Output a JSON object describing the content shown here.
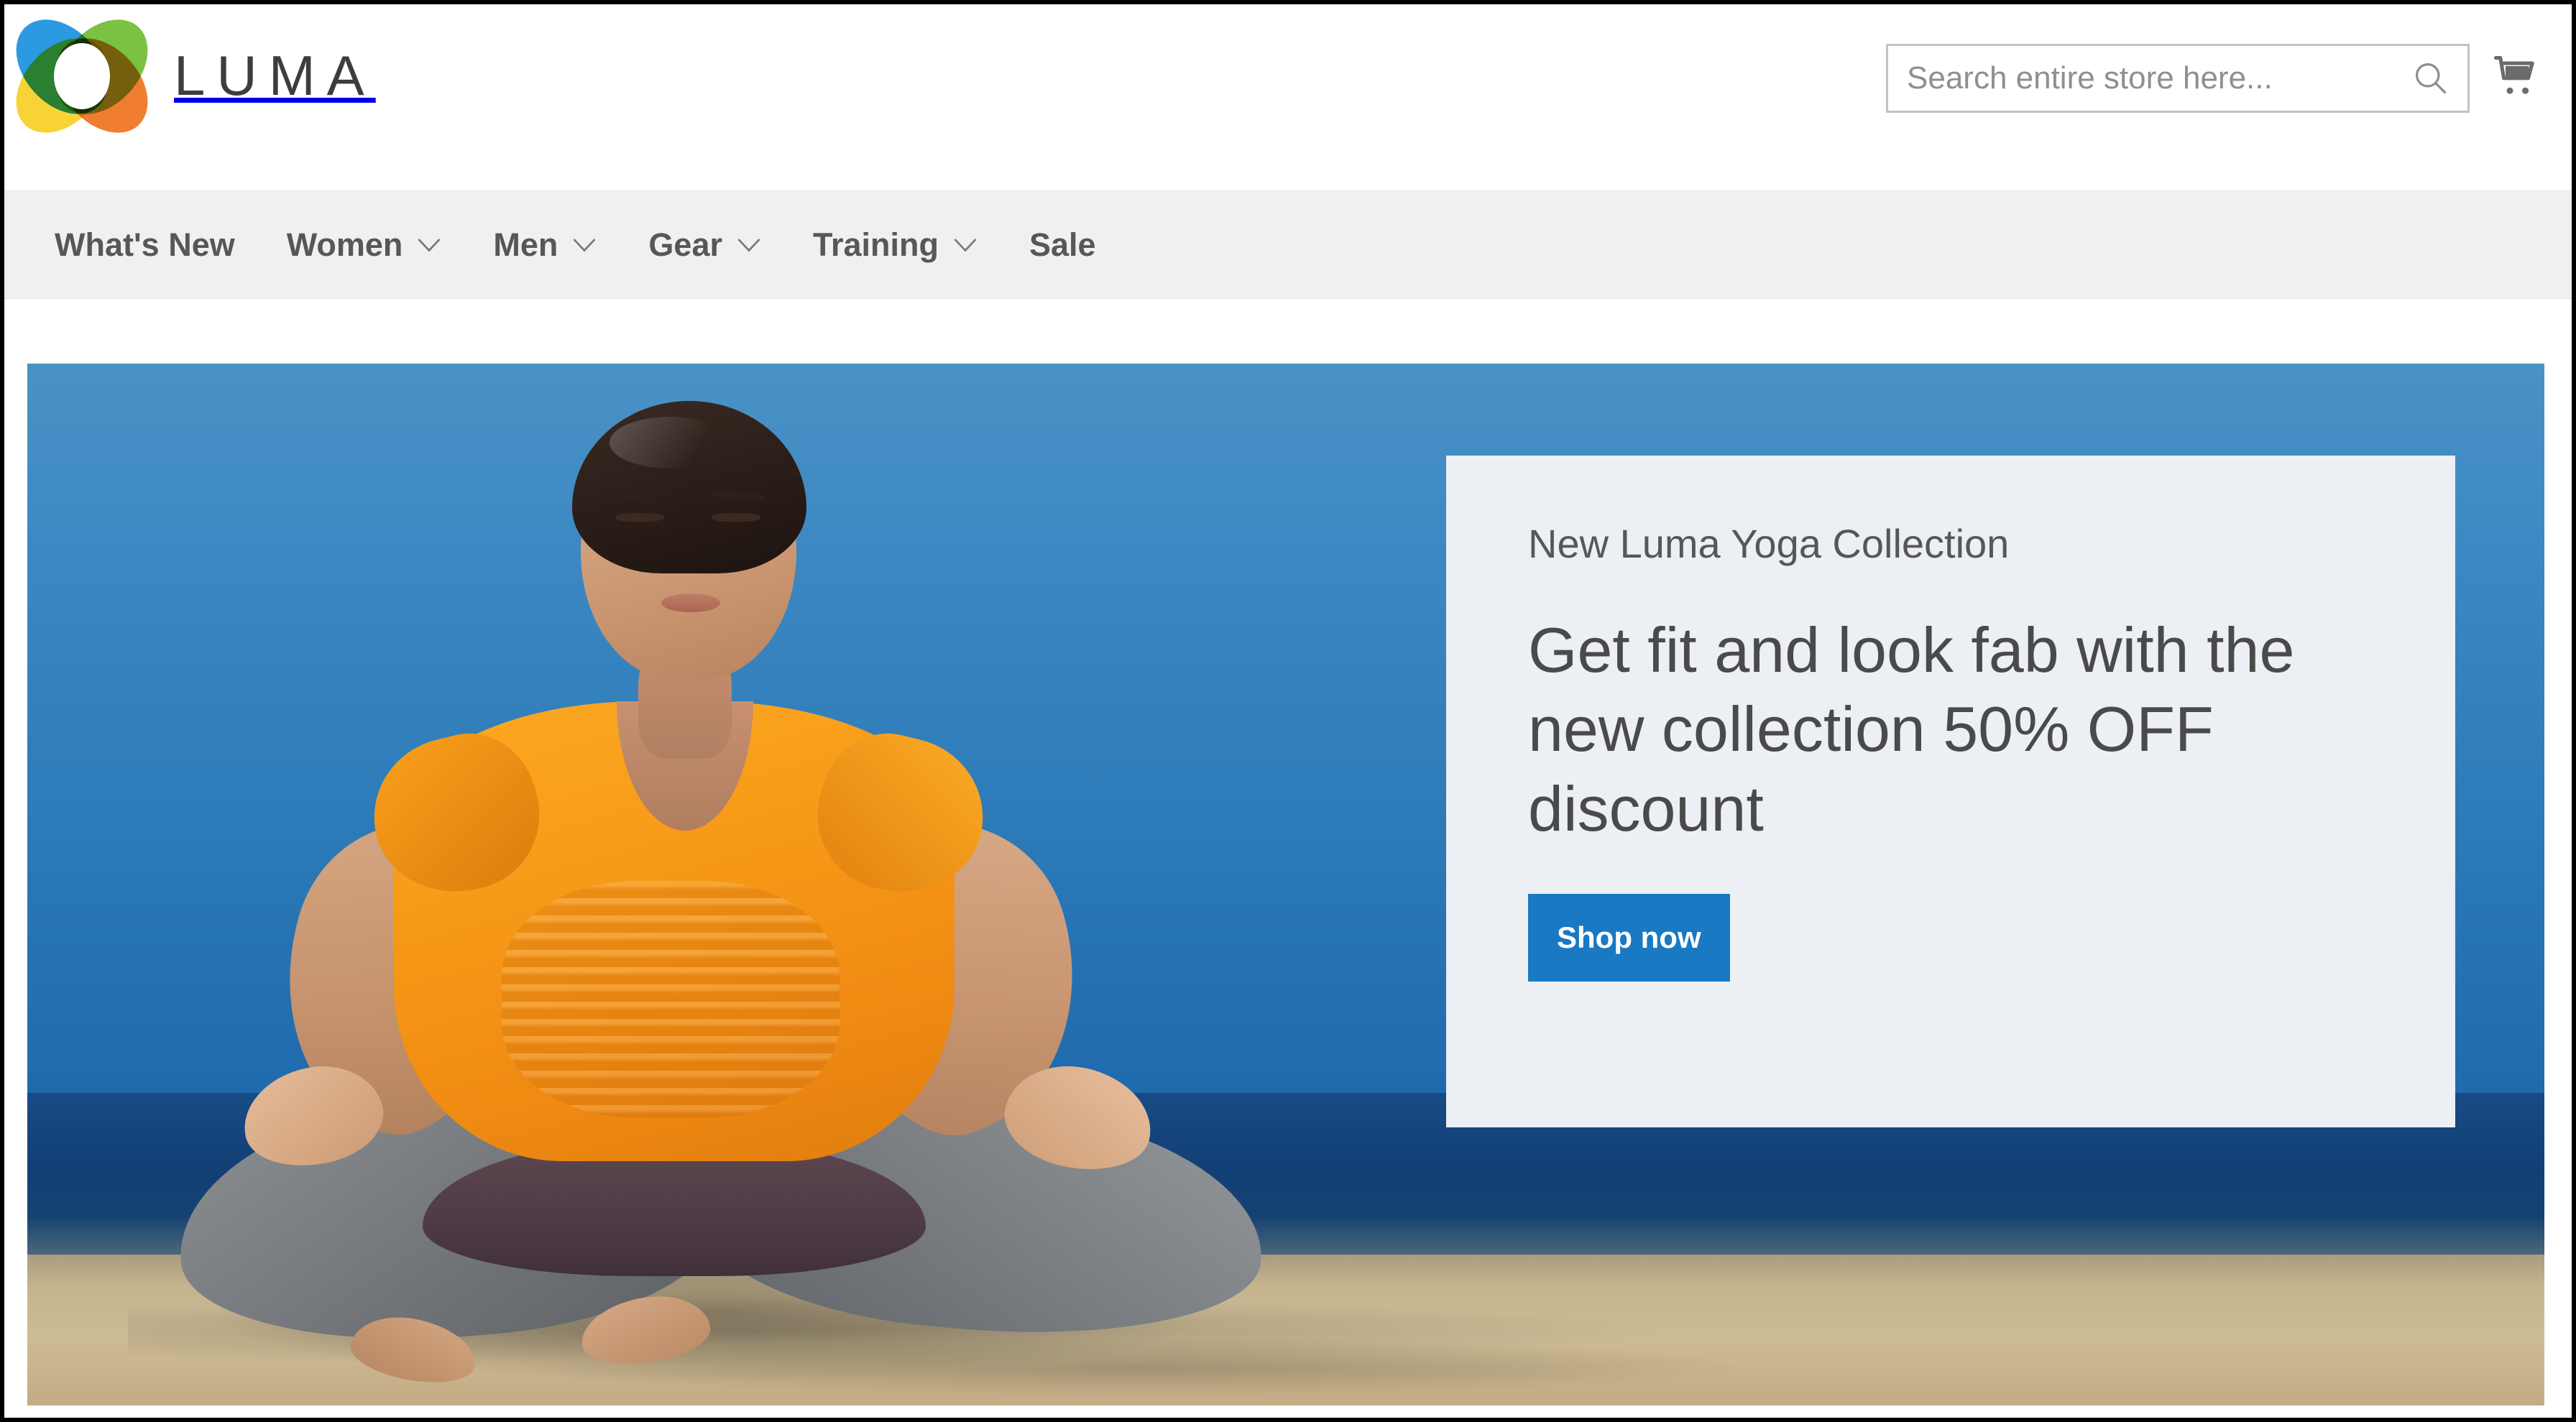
{
  "header": {
    "logo_text": "LUMA",
    "logo_colors": {
      "blue": "#2b9ae0",
      "green": "#7cc242",
      "orange": "#f07d30",
      "yellow": "#f7d336",
      "wordmark": "#3d3d3d"
    },
    "search": {
      "placeholder": "Search entire store here...",
      "value": "",
      "icon": "search-icon"
    },
    "cart": {
      "icon": "shopping-cart-icon",
      "count": ""
    }
  },
  "nav": {
    "items": [
      {
        "label": "What's New",
        "has_dropdown": false
      },
      {
        "label": "Women",
        "has_dropdown": true
      },
      {
        "label": "Men",
        "has_dropdown": true
      },
      {
        "label": "Gear",
        "has_dropdown": true
      },
      {
        "label": "Training",
        "has_dropdown": true
      },
      {
        "label": "Sale",
        "has_dropdown": false
      }
    ],
    "background": "#f0f0f0",
    "text_color": "#575757"
  },
  "hero": {
    "image_alt": "Woman meditating in lotus pose on a beach at the ocean shore",
    "scene": {
      "sky_color": "#3b87c2",
      "ocean_color": "#143f78",
      "sand_color": "#c6b48e",
      "shirt_color": "#f79a18",
      "leggings_color": "#7a7d81"
    },
    "promo": {
      "eyebrow": "New Luma Yoga Collection",
      "headline": "Get fit and look fab with the new collection 50% OFF discount",
      "cta_label": "Shop now",
      "cta_color": "#1979c3",
      "panel_background": "#eceff3"
    }
  }
}
